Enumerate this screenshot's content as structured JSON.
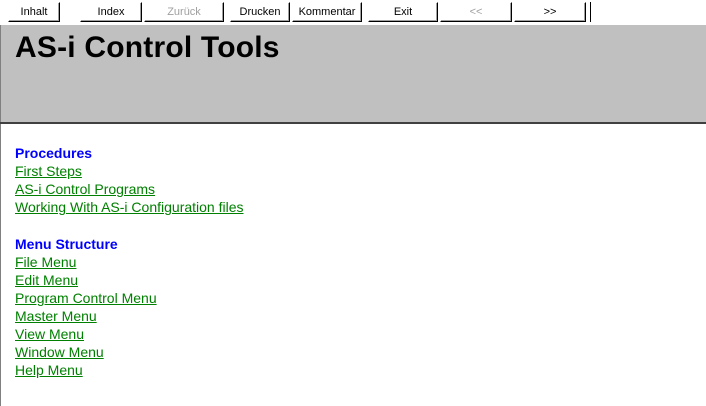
{
  "toolbar": {
    "buttons": [
      {
        "label": "Inhalt",
        "disabled": false
      },
      {
        "label": "Index",
        "disabled": false
      },
      {
        "label": "Zurück",
        "disabled": true
      },
      {
        "label": "Drucken",
        "disabled": false
      },
      {
        "label": "Kommentar",
        "disabled": false
      },
      {
        "label": "Exit",
        "disabled": false
      },
      {
        "label": "<<",
        "disabled": true
      },
      {
        "label": ">>",
        "disabled": false
      }
    ]
  },
  "header": {
    "title": "AS-i Control Tools",
    "background": "#c0c0c0"
  },
  "content": {
    "sections": [
      {
        "title": "Procedures",
        "links": [
          "First Steps",
          "AS-i Control Programs",
          "Working With AS-i Configuration files"
        ]
      },
      {
        "title": "Menu Structure",
        "links": [
          "File Menu",
          "Edit Menu",
          "Program Control Menu",
          "Master Menu",
          "View Menu",
          "Window Menu",
          "Help Menu"
        ]
      }
    ],
    "colors": {
      "section_title": "#0000ff",
      "link": "#008000"
    }
  }
}
